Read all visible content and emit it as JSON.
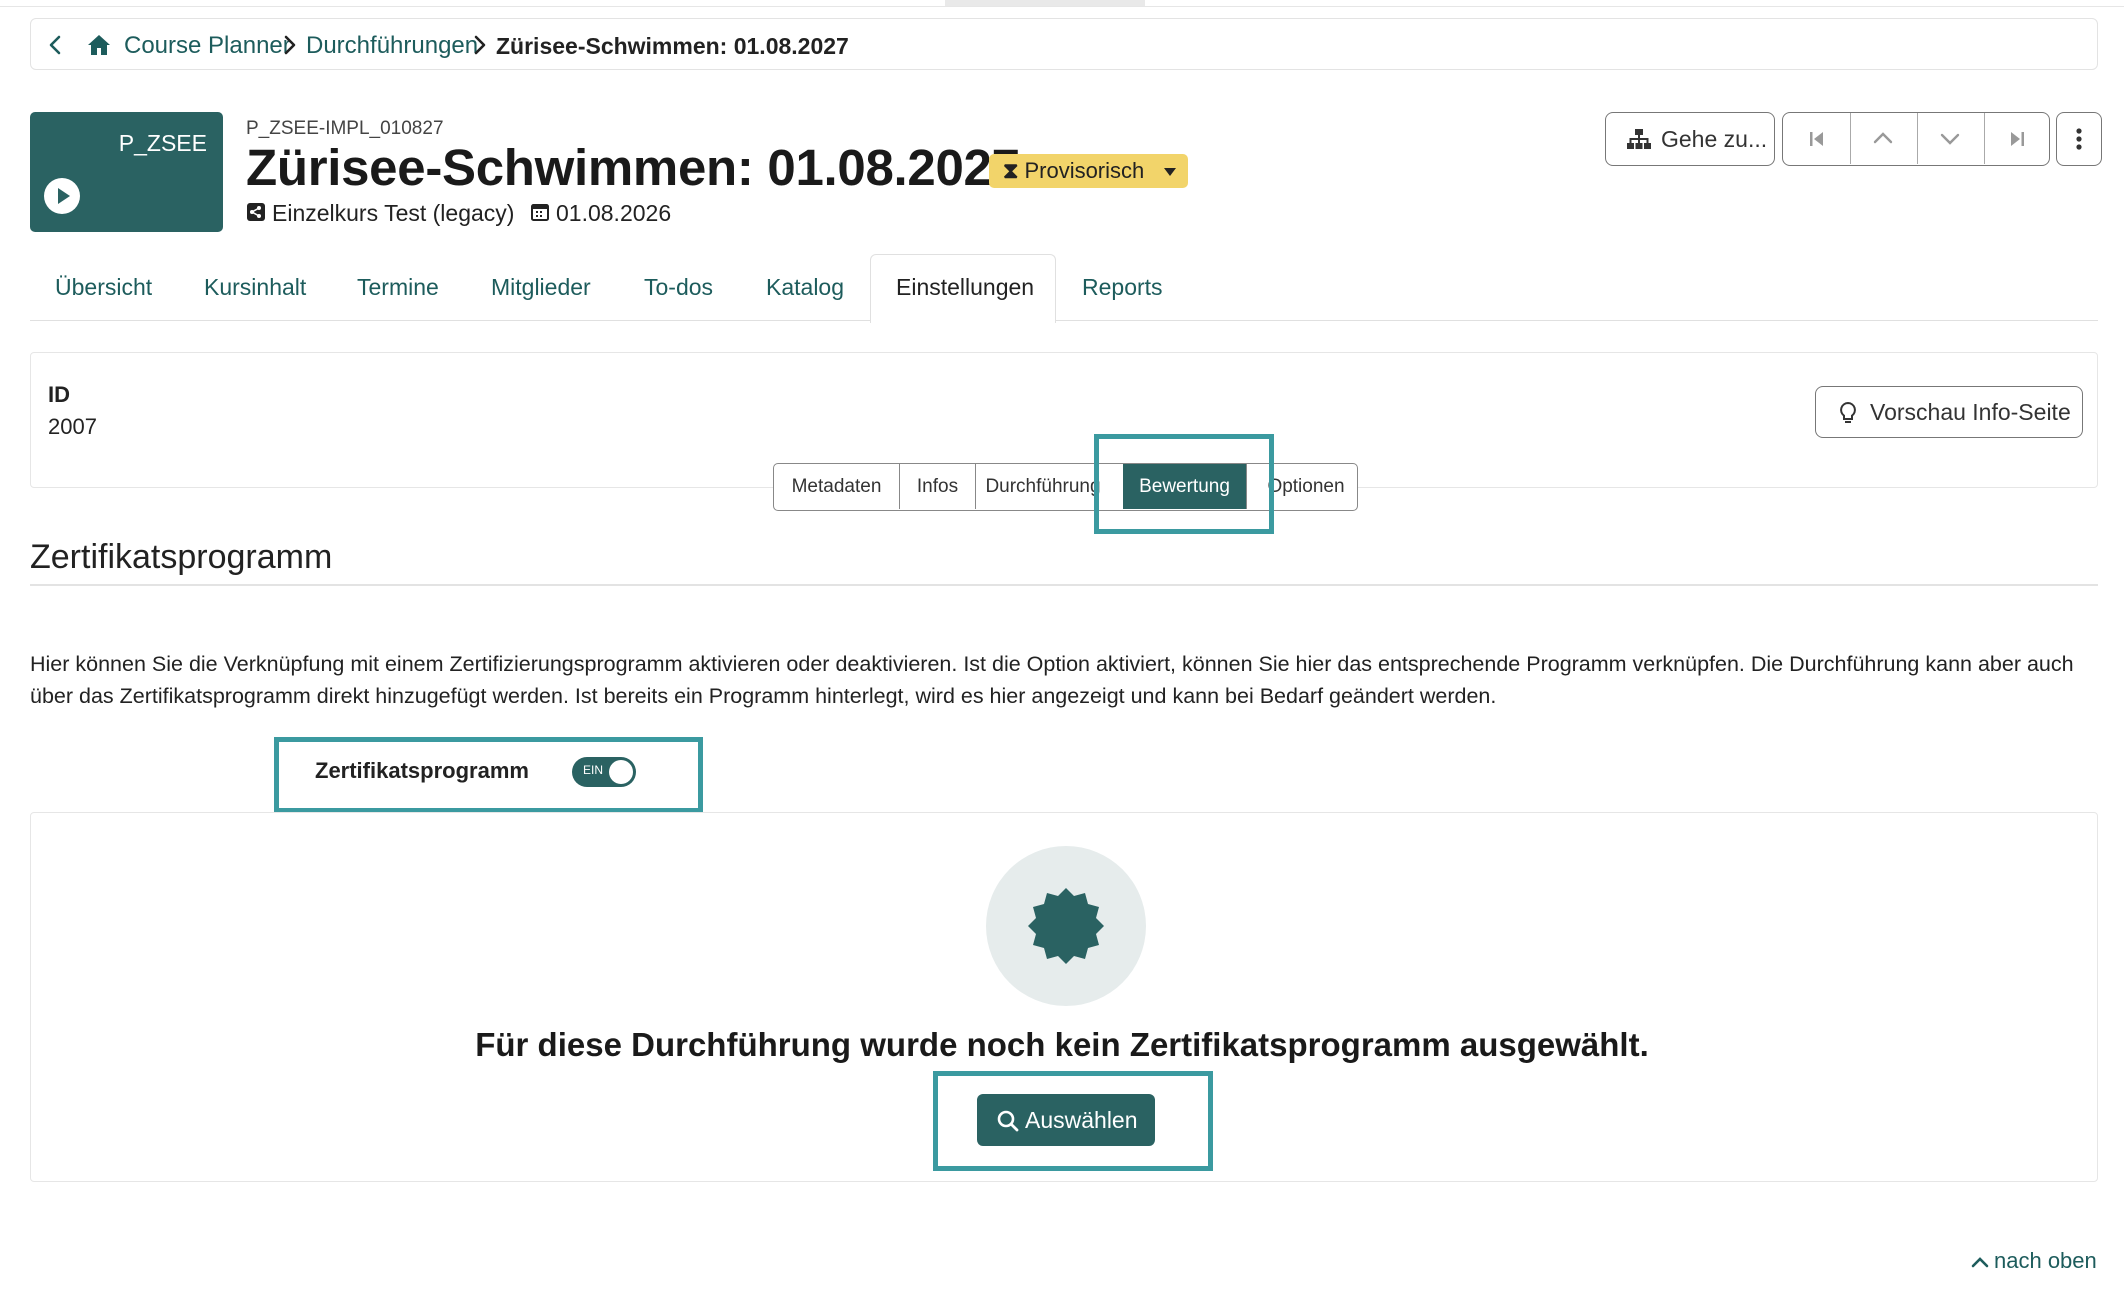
{
  "breadcrumb": {
    "items": [
      "Course Planner",
      "Durchführungen"
    ],
    "current": "Zürisee-Schwimmen: 01.08.2027"
  },
  "header": {
    "tile_code": "P_ZSEE",
    "impl_id": "P_ZSEE-IMPL_010827",
    "title": "Zürisee-Schwimmen: 01.08.2027",
    "status": "Provisorisch",
    "course": "Einzelkurs Test (legacy)",
    "date": "01.08.2026",
    "goto_label": "Gehe zu..."
  },
  "tabs": [
    "Übersicht",
    "Kursinhalt",
    "Termine",
    "Mitglieder",
    "To-dos",
    "Katalog",
    "Einstellungen",
    "Reports"
  ],
  "active_tab": "Einstellungen",
  "idpanel": {
    "id_label": "ID",
    "id_value": "2007",
    "preview_label": "Vorschau Info-Seite"
  },
  "subtabs": [
    "Metadaten",
    "Infos",
    "Durchführung",
    "Bewertung",
    "Optionen"
  ],
  "active_subtab": "Bewertung",
  "section": {
    "title": "Zertifikatsprogramm",
    "description": "Hier können Sie die Verknüpfung mit einem Zertifizierungsprogramm aktivieren oder deaktivieren. Ist die Option aktiviert, können Sie hier das entsprechende Programm verknüpfen. Die Durchführung kann aber auch über das Zertifikatsprogramm direkt hinzugefügt werden. Ist bereits ein Programm hinterlegt, wird es hier angezeigt und kann bei Bedarf geändert werden.",
    "toggle_label": "Zertifikatsprogramm",
    "toggle_state": "EIN"
  },
  "empty_state": {
    "message": "Für diese Durchführung wurde noch kein Zertifikatsprogramm ausgewählt.",
    "button": "Auswählen"
  },
  "footer": {
    "back_to_top": "nach oben"
  },
  "colors": {
    "primary": "#2a6262",
    "highlight": "#3b9aa0",
    "status": "#f2d46a"
  }
}
